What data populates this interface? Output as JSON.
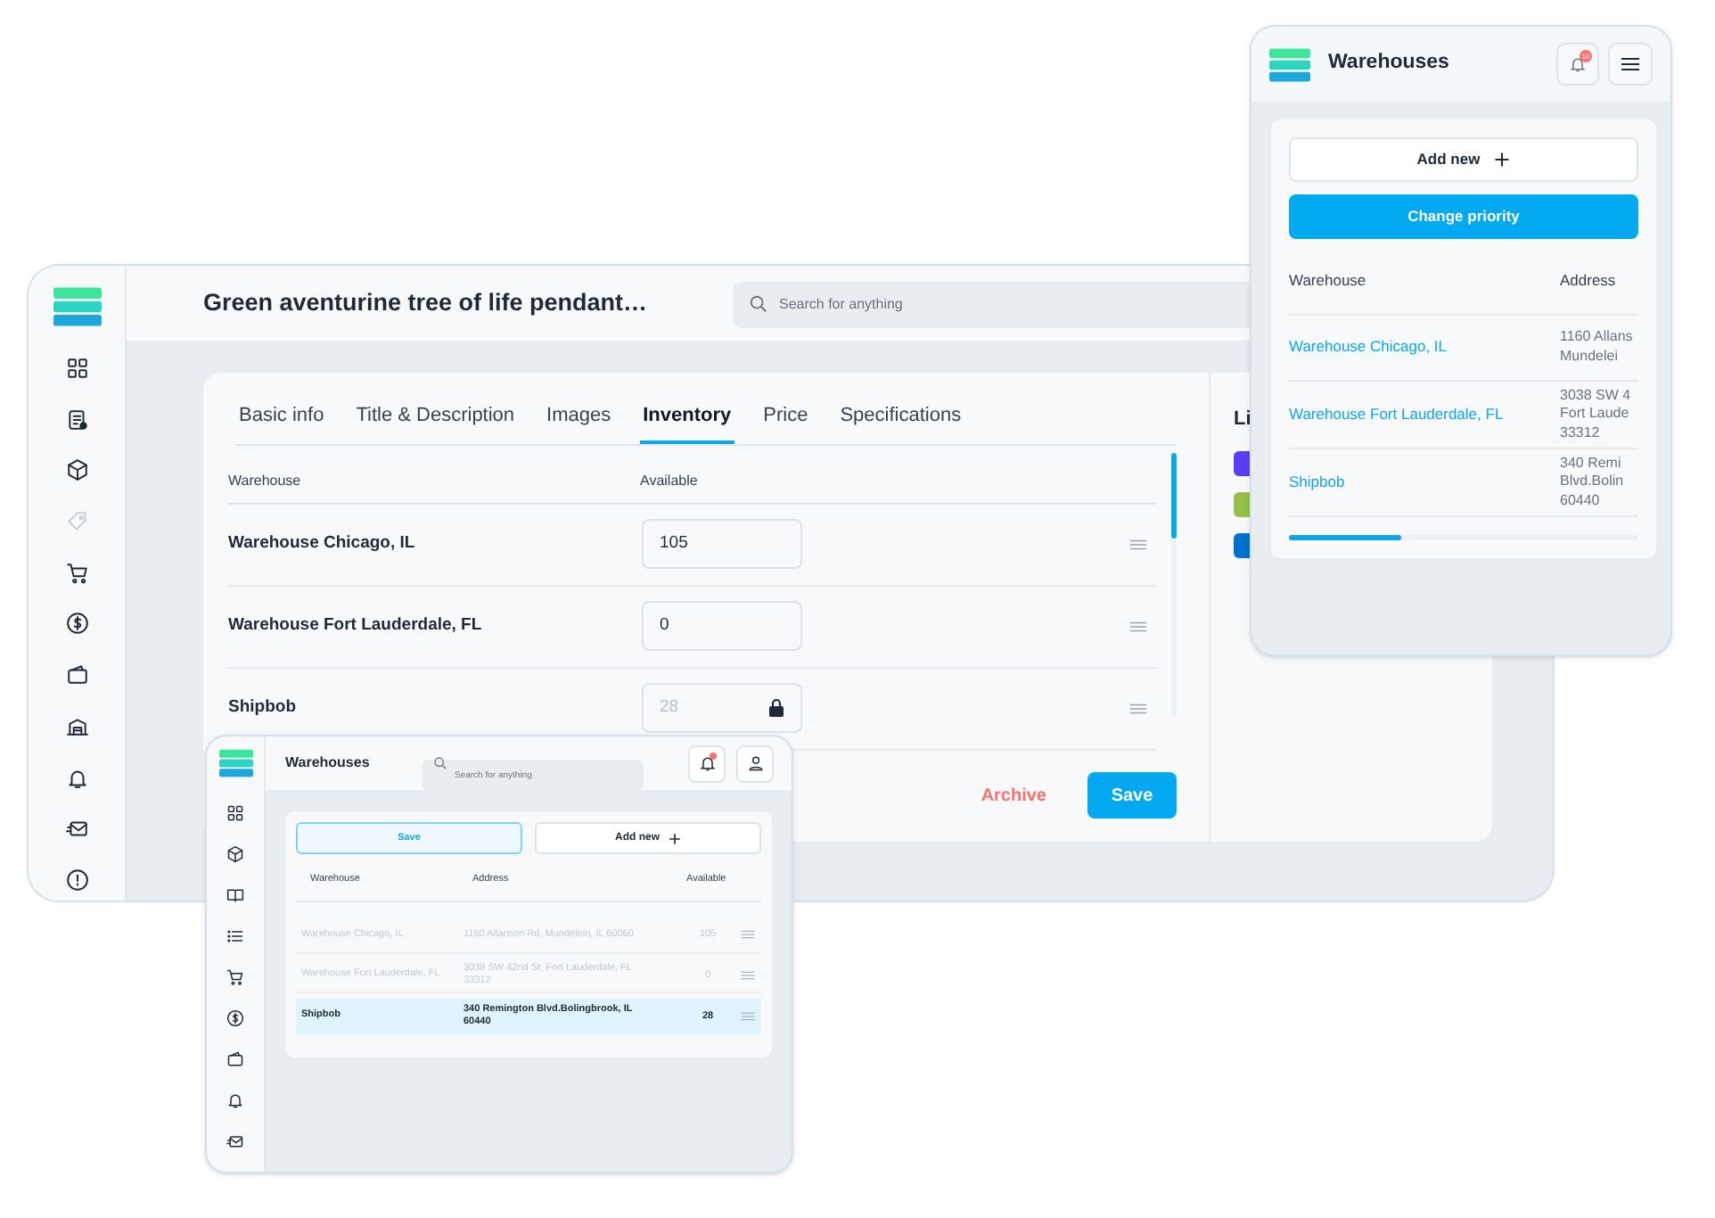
{
  "main_window": {
    "title": "Green aventurine tree of life pendant…",
    "search": {
      "placeholder": "Search for anything"
    },
    "sidebar": [
      {
        "kind": "dashboard",
        "disabled": false
      },
      {
        "kind": "document",
        "disabled": false
      },
      {
        "kind": "box",
        "disabled": false
      },
      {
        "kind": "tag",
        "disabled": true
      },
      {
        "kind": "cart",
        "disabled": false
      },
      {
        "kind": "dollar",
        "disabled": false
      },
      {
        "kind": "wallet",
        "disabled": false
      },
      {
        "kind": "warehouse",
        "disabled": false
      },
      {
        "kind": "bell",
        "disabled": false
      },
      {
        "kind": "mail",
        "disabled": false
      },
      {
        "kind": "info",
        "disabled": false
      }
    ],
    "tabs": [
      {
        "label": "Basic info",
        "selected": false
      },
      {
        "label": "Title & Description",
        "selected": false
      },
      {
        "label": "Images",
        "selected": false
      },
      {
        "label": "Inventory",
        "selected": true
      },
      {
        "label": "Price",
        "selected": false
      },
      {
        "label": "Specifications",
        "selected": false
      }
    ],
    "table": {
      "columns": [
        "Warehouse",
        "Available"
      ],
      "rows": [
        {
          "warehouse": "Warehouse Chicago, IL",
          "available": "105",
          "locked": false
        },
        {
          "warehouse": "Warehouse Fort Lauderdale, FL",
          "available": "0",
          "locked": false
        },
        {
          "warehouse": "Shipbob",
          "available": "28",
          "locked": true
        }
      ]
    },
    "actions": {
      "archive": "Archive",
      "save": "Save"
    },
    "side_panel": {
      "title": "Li",
      "channels": [
        {
          "color": "#5b3df5"
        },
        {
          "color": "#95bf47"
        },
        {
          "color": "#0071ce"
        }
      ]
    }
  },
  "mobile_window": {
    "title": "Warehouses",
    "notifications": "10",
    "add_new": "Add new",
    "change_priority": "Change priority",
    "table": {
      "columns": [
        "Warehouse",
        "Address"
      ],
      "rows": [
        {
          "warehouse": "Warehouse Chicago, IL",
          "address": [
            "1160 Allans",
            "Mundelei"
          ]
        },
        {
          "warehouse": "Warehouse Fort Lauderdale, FL",
          "address": [
            "3038 SW 4",
            "Fort Laude",
            "33312"
          ]
        },
        {
          "warehouse": "Shipbob",
          "address": [
            "340 Remi",
            "Blvd.Bolin",
            "60440"
          ]
        }
      ]
    }
  },
  "small_window": {
    "title": "Warehouses",
    "search": {
      "placeholder": "Search for anything"
    },
    "sidebar": [
      {
        "kind": "dashboard"
      },
      {
        "kind": "box"
      },
      {
        "kind": "book"
      },
      {
        "kind": "list"
      },
      {
        "kind": "cart"
      },
      {
        "kind": "dollar"
      },
      {
        "kind": "wallet"
      },
      {
        "kind": "bell"
      },
      {
        "kind": "mail"
      }
    ],
    "save": "Save",
    "add_new": "Add new",
    "table": {
      "columns": [
        "Warehouse",
        "Address",
        "Available"
      ],
      "rows": [
        {
          "warehouse": "Warehouse Chicago, IL",
          "address": "1160 Allanson Rd, Mundelein, IL 60060",
          "available": "105",
          "selected": false
        },
        {
          "warehouse": "Warehouse Fort Lauderdale, FL",
          "address": "3038 SW 42nd St, Fort Lauderdale, FL 33312",
          "available": "0",
          "selected": false
        },
        {
          "warehouse": "Shipbob",
          "address": "340 Remington Blvd.Bolingbrook, IL 60440",
          "available": "28",
          "selected": true
        }
      ]
    }
  }
}
